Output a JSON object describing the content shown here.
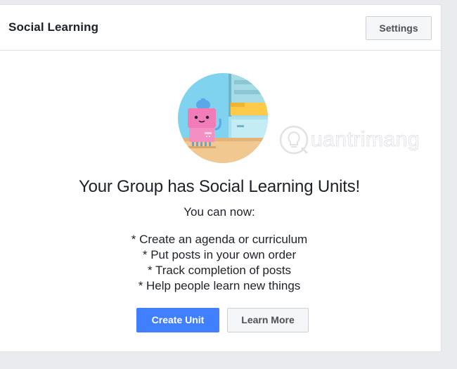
{
  "header": {
    "title": "Social Learning",
    "settings_label": "Settings"
  },
  "content": {
    "headline": "Your Group has Social Learning Units!",
    "subheading": "You can now:",
    "features": [
      "* Create an agenda or curriculum",
      "* Put posts in your own order",
      "* Track completion of posts",
      "* Help people learn new things"
    ]
  },
  "actions": {
    "create_unit_label": "Create Unit",
    "learn_more_label": "Learn More"
  },
  "watermark": {
    "text": "uantrimang",
    "icon": "lightbulb-icon"
  },
  "illustration": {
    "icon": "robot-learning-icon"
  },
  "colors": {
    "primary": "#4080ff",
    "background": "#e9ebee",
    "card": "#ffffff",
    "border": "#dddfe2",
    "text": "#1d2129",
    "secondary_text": "#4b4f56"
  }
}
